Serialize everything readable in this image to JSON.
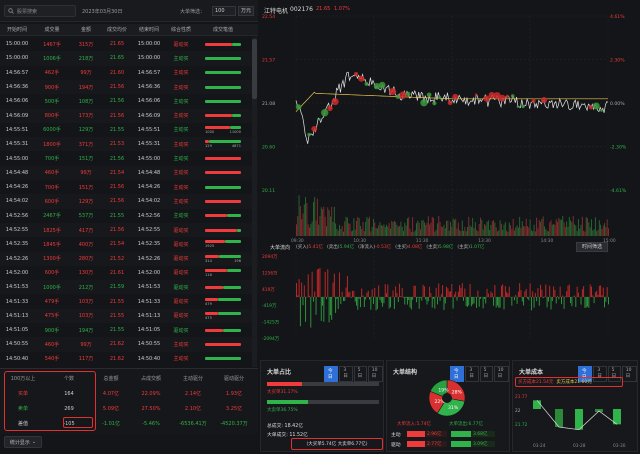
{
  "search": {
    "placeholder": "股票搜索",
    "date": "2023年03月30日",
    "filter_label": "大单筛选：",
    "filter_value": "100",
    "filter_unit": "万元"
  },
  "table": {
    "headers": [
      "开始时间",
      "成交量",
      "金额",
      "成交均价",
      "结束时间",
      "综合性质",
      "成交笔值"
    ],
    "rows": [
      {
        "start": "15:00:00",
        "vol": "1467手",
        "amt": "315万",
        "avg": "21.65",
        "end": "15:00:00",
        "nature": "驱动买",
        "c": "red",
        "bar": [
          0.75,
          0.25
        ],
        "nums": [
          "",
          ""
        ]
      },
      {
        "start": "15:00:00",
        "vol": "1006手",
        "amt": "218万",
        "avg": "21.65",
        "end": "15:00:00",
        "nature": "主动买",
        "c": "green",
        "bar": [
          0,
          1
        ],
        "nums": [
          "",
          ""
        ]
      },
      {
        "start": "14:56:57",
        "vol": "462手",
        "amt": "99万",
        "avg": "21.60",
        "end": "14:56:57",
        "nature": "主动买",
        "c": "red",
        "bar": [
          0,
          1
        ],
        "nums": [
          "",
          ""
        ]
      },
      {
        "start": "14:56:36",
        "vol": "900手",
        "amt": "194万",
        "avg": "21.56",
        "end": "14:56:36",
        "nature": "主动买",
        "c": "red",
        "bar": [
          0,
          1
        ],
        "nums": [
          "",
          ""
        ]
      },
      {
        "start": "14:56:06",
        "vol": "500手",
        "amt": "108万",
        "avg": "21.56",
        "end": "14:56:06",
        "nature": "主动买",
        "c": "green",
        "bar": [
          0,
          1
        ],
        "nums": [
          "",
          ""
        ]
      },
      {
        "start": "14:56:09",
        "vol": "800手",
        "amt": "173万",
        "avg": "21.56",
        "end": "14:56:09",
        "nature": "主动买",
        "c": "red",
        "bar": [
          0.75,
          0.25
        ],
        "nums": [
          "",
          ""
        ]
      },
      {
        "start": "14:55:51",
        "vol": "6000手",
        "amt": "129万",
        "avg": "21.55",
        "end": "14:55:51",
        "nature": "主动买",
        "c": "green",
        "bar": [
          0.7,
          0.3
        ],
        "nums": [
          "1000",
          "11000"
        ]
      },
      {
        "start": "14:55:31",
        "vol": "1800手",
        "amt": "371万",
        "avg": "21.53",
        "end": "14:55:31",
        "nature": "主动买",
        "c": "red",
        "bar": [
          0.1,
          0.9
        ],
        "nums": [
          "129",
          "4871"
        ]
      },
      {
        "start": "14:55:00",
        "vol": "700手",
        "amt": "151万",
        "avg": "21.56",
        "end": "14:55:00",
        "nature": "主动买",
        "c": "green",
        "bar": [
          1,
          0
        ],
        "nums": [
          "",
          ""
        ]
      },
      {
        "start": "14:54:48",
        "vol": "460手",
        "amt": "99万",
        "avg": "21.54",
        "end": "14:54:48",
        "nature": "主动买",
        "c": "red",
        "bar": [
          1,
          0
        ],
        "nums": [
          "",
          ""
        ]
      },
      {
        "start": "14:54:26",
        "vol": "700手",
        "amt": "151万",
        "avg": "21.56",
        "end": "14:54:26",
        "nature": "主动买",
        "c": "red",
        "bar": [
          0,
          1
        ],
        "nums": [
          "",
          ""
        ]
      },
      {
        "start": "14:54:02",
        "vol": "600手",
        "amt": "129万",
        "avg": "21.56",
        "end": "14:54:02",
        "nature": "主动买",
        "c": "red",
        "bar": [
          1,
          0
        ],
        "nums": [
          "",
          ""
        ]
      },
      {
        "start": "14:52:56",
        "vol": "2467手",
        "amt": "537万",
        "avg": "21.55",
        "end": "14:52:56",
        "nature": "主动买",
        "c": "green",
        "bar": [
          0.6,
          0.4
        ],
        "nums": [
          "",
          ""
        ]
      },
      {
        "start": "14:52:55",
        "vol": "1825手",
        "amt": "417万",
        "avg": "21.56",
        "end": "14:52:55",
        "nature": "驱动买",
        "c": "red",
        "bar": [
          0.9,
          0.1
        ],
        "nums": [
          "",
          ""
        ]
      },
      {
        "start": "14:52:35",
        "vol": "1845手",
        "amt": "400万",
        "avg": "21.54",
        "end": "14:52:35",
        "nature": "驱动买",
        "c": "red",
        "bar": [
          0.55,
          0.45
        ],
        "nums": [
          "1925",
          ""
        ]
      },
      {
        "start": "14:52:26",
        "vol": "1300手",
        "amt": "280万",
        "avg": "21.52",
        "end": "14:52:26",
        "nature": "驱动买",
        "c": "red",
        "bar": [
          0.4,
          0.6
        ],
        "nums": [
          "314",
          "196"
        ]
      },
      {
        "start": "14:52:00",
        "vol": "600手",
        "amt": "130万",
        "avg": "21.61",
        "end": "14:52:00",
        "nature": "驱动买",
        "c": "red",
        "bar": [
          0.6,
          0.4
        ],
        "nums": [
          "116",
          ""
        ]
      },
      {
        "start": "14:51:53",
        "vol": "1000手",
        "amt": "212万",
        "avg": "21.59",
        "end": "14:51:53",
        "nature": "驱动买",
        "c": "green",
        "bar": [
          0.5,
          0.5
        ],
        "nums": [
          "",
          ""
        ]
      },
      {
        "start": "14:51:33",
        "vol": "479手",
        "amt": "103万",
        "avg": "21.55",
        "end": "14:51:33",
        "nature": "驱动买",
        "c": "red",
        "bar": [
          0.35,
          0.65
        ],
        "nums": [
          "479",
          ""
        ]
      },
      {
        "start": "14:51:13",
        "vol": "475手",
        "amt": "103万",
        "avg": "21.55",
        "end": "14:51:13",
        "nature": "驱动买",
        "c": "red",
        "bar": [
          0.35,
          0.65
        ],
        "nums": [
          "475",
          ""
        ]
      },
      {
        "start": "14:51:05",
        "vol": "900手",
        "amt": "194万",
        "avg": "21.55",
        "end": "14:51:05",
        "nature": "驱动买",
        "c": "green",
        "bar": [
          0.5,
          0.5
        ],
        "nums": [
          "",
          ""
        ]
      },
      {
        "start": "14:50:55",
        "vol": "460手",
        "amt": "99万",
        "avg": "21.62",
        "end": "14:50:55",
        "nature": "主动买",
        "c": "red",
        "bar": [
          1,
          0
        ],
        "nums": [
          "",
          ""
        ]
      },
      {
        "start": "14:50:40",
        "vol": "540手",
        "amt": "117万",
        "avg": "21.62",
        "end": "14:50:40",
        "nature": "主动买",
        "c": "red",
        "bar": [
          0,
          1
        ],
        "nums": [
          "",
          ""
        ]
      }
    ]
  },
  "summary": {
    "headers": [
      "100万以上",
      "个数",
      "总金额",
      "占成交额",
      "主动驱分",
      "驱动驱分"
    ],
    "rows": [
      {
        "label": "买单",
        "count": "164",
        "total": "4.07亿",
        "pct": "22.09%",
        "active": "2.14亿",
        "drive": "1.93亿"
      },
      {
        "label": "卖单",
        "count": "269",
        "total": "5.09亿",
        "pct": "27.50%",
        "active": "2.10亿",
        "drive": "3.25亿"
      },
      {
        "label": "差值",
        "count": "-105",
        "total": "-1.01亿",
        "pct": "-5.46%",
        "active": "-6536.41万",
        "drive": "-4520.37万"
      }
    ],
    "btn": "统计显示"
  },
  "chart": {
    "title": "江特电机",
    "code": "002176",
    "price": "21.65",
    "change": "1.07%",
    "y_left": [
      "22.54",
      "21.57",
      "21.08",
      "20.60",
      "20.11"
    ],
    "y_right": [
      "4.61%",
      "2.30%",
      "0.00%",
      "-2.30%",
      "-4.61%"
    ],
    "x_ticks": [
      "09:30",
      "10:30",
      "11:30",
      "13:30",
      "14:30",
      "15:00"
    ],
    "big_label": "大单流向",
    "big_items": [
      {
        "t": "(买入)",
        "v": "5.41亿",
        "c": "red"
      },
      {
        "t": "(卖出)",
        "v": "5.94亿",
        "c": "green"
      },
      {
        "t": "(净流入)",
        "v": "-0.53亿",
        "c": "red"
      },
      {
        "t": "(主买)",
        "v": "4.08亿",
        "c": "red"
      },
      {
        "t": "(主卖)",
        "v": "5.98亿",
        "c": "green"
      },
      {
        "t": "(主卖)",
        "v": "1.07亿",
        "c": "green"
      }
    ],
    "big_btn": "时间筛选",
    "flow_y": [
      "2094万",
      "1256万",
      "419万",
      "-419万",
      "-1425万",
      "-2094万"
    ]
  },
  "panel1": {
    "title": "大单占比",
    "tabs": [
      "今日",
      "3日",
      "5日",
      "10日"
    ],
    "buy_label": "大买单31.17%",
    "sell_label": "大卖单36.75%",
    "total": "总成交: 18.42亿",
    "big": "大单成交: 11.52亿",
    "box": "(大买单5.74亿 大卖单6.77亿)"
  },
  "panel2": {
    "title": "大单结构",
    "tabs": [
      "今日",
      "3日",
      "5日",
      "10日"
    ],
    "pie": [
      {
        "l": "28%",
        "c": "#ee3b3b"
      },
      {
        "l": "31%",
        "c": "#2fb34a"
      },
      {
        "l": "22%",
        "c": "#2fb34a"
      },
      {
        "l": "19%",
        "c": "#ee3b3b"
      }
    ],
    "inflow": "大单流入:5.74亿",
    "outflow": "大单流出:6.77亿",
    "r1": {
      "l": "主动",
      "a": "2.96亿",
      "b": "3.68亿"
    },
    "r2": {
      "l": "驱动",
      "a": "2.77亿",
      "b": "3.09亿"
    }
  },
  "panel3": {
    "title": "大单成本",
    "tabs": [
      "今日",
      "3日",
      "5日",
      "10日"
    ],
    "buy": "买方成本21.54元",
    "sell": "卖方成本21.60元",
    "y": [
      "21.77",
      "22",
      "21.72"
    ],
    "x": [
      "03-24",
      "03-28",
      "03-30"
    ],
    "series": [
      22.6,
      21.6,
      21.5,
      22.2,
      21.7
    ]
  }
}
